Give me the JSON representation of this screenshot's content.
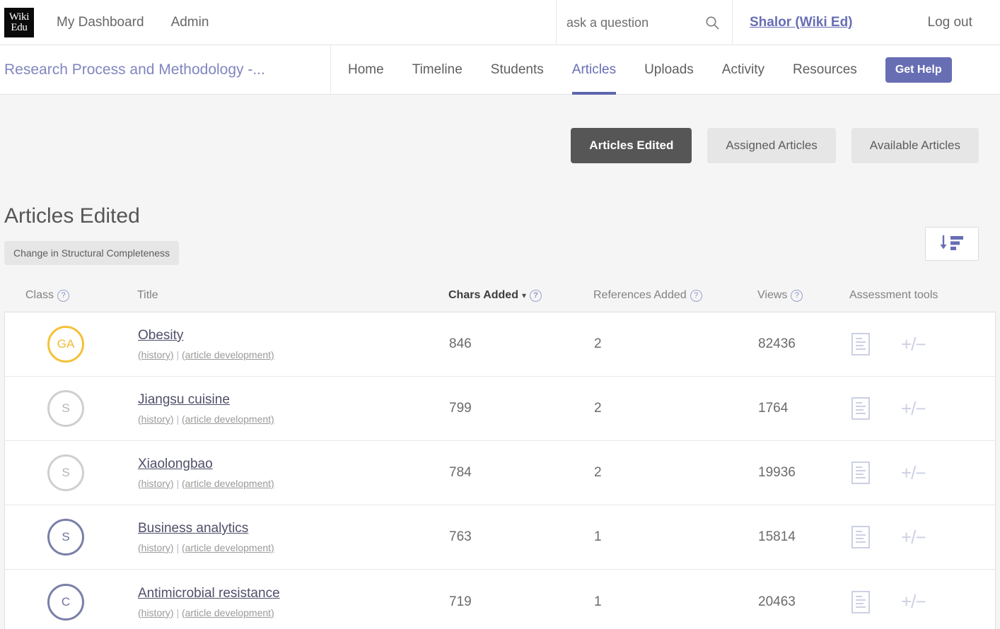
{
  "topbar": {
    "logo_line1": "Wiki",
    "logo_line2": "Edu",
    "nav": [
      {
        "label": "My Dashboard",
        "name": "my-dashboard"
      },
      {
        "label": "Admin",
        "name": "admin"
      }
    ],
    "search": {
      "placeholder": "ask a question",
      "value": "",
      "icon": "search-icon"
    },
    "user_link": "Shalor (Wiki Ed)",
    "logout": "Log out"
  },
  "coursebar": {
    "course_title": "Research Process and Methodology -...",
    "tabs": [
      {
        "label": "Home",
        "active": false
      },
      {
        "label": "Timeline",
        "active": false
      },
      {
        "label": "Students",
        "active": false
      },
      {
        "label": "Articles",
        "active": true
      },
      {
        "label": "Uploads",
        "active": false
      },
      {
        "label": "Activity",
        "active": false
      },
      {
        "label": "Resources",
        "active": false
      }
    ],
    "get_help": "Get Help"
  },
  "toggles": [
    {
      "label": "Articles Edited",
      "active": true
    },
    {
      "label": "Assigned Articles",
      "active": false
    },
    {
      "label": "Available Articles",
      "active": false
    }
  ],
  "section": {
    "title": "Articles Edited",
    "pill": "Change in Structural Completeness",
    "sort_icon": "sort-descending-icon"
  },
  "table": {
    "headers": {
      "class": "Class",
      "title": "Title",
      "chars_added": "Chars Added",
      "references_added": "References Added",
      "views": "Views",
      "assessment_tools": "Assessment tools"
    },
    "sub_links": {
      "history": "(history)",
      "separator": "|",
      "development": "(article development)"
    },
    "rows": [
      {
        "class": "GA",
        "class_style": "ga",
        "title": "Obesity",
        "chars_added": "846",
        "references_added": "2",
        "views": "82436"
      },
      {
        "class": "S",
        "class_style": "gray",
        "title": "Jiangsu cuisine",
        "chars_added": "799",
        "references_added": "2",
        "views": "1764"
      },
      {
        "class": "S",
        "class_style": "gray",
        "title": "Xiaolongbao",
        "chars_added": "784",
        "references_added": "2",
        "views": "19936"
      },
      {
        "class": "S",
        "class_style": "purple",
        "title": "Business analytics",
        "chars_added": "763",
        "references_added": "1",
        "views": "15814"
      },
      {
        "class": "C",
        "class_style": "purple",
        "title": "Antimicrobial resistance",
        "chars_added": "719",
        "references_added": "1",
        "views": "20463"
      }
    ]
  },
  "colors": {
    "accent_purple": "#676eb4",
    "active_toggle": "#565656",
    "ga_gold": "#f5c137",
    "class_purple": "#7a7fa8",
    "page_bg": "#f5f5f5"
  }
}
